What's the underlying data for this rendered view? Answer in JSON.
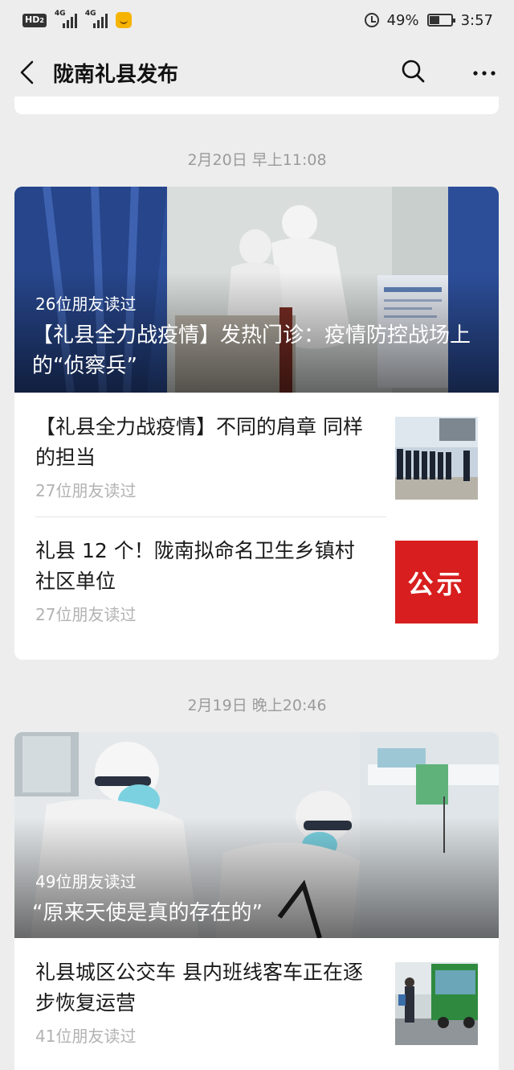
{
  "status_bar": {
    "hd": "HD",
    "hd_sub": "2",
    "net1": "4G",
    "net2": "4G",
    "battery_pct": "49%",
    "time": "3:57"
  },
  "header": {
    "title": "陇南礼县发布",
    "icons": [
      "back-icon",
      "search-icon",
      "more-icon"
    ]
  },
  "groups": [
    {
      "date": "2月20日 早上11:08",
      "hero": {
        "reads": "26位朋友读过",
        "title": "【礼县全力战疫情】发热门诊：疫情防控战场上的“侦察兵”"
      },
      "items": [
        {
          "title": "【礼县全力战疫情】不同的肩章 同样的担当",
          "reads": "27位朋友读过"
        },
        {
          "title": "礼县 12 个！陇南拟命名卫生乡镇村社区单位",
          "reads": "27位朋友读过",
          "thumb_text": "公示"
        }
      ]
    },
    {
      "date": "2月19日 晚上20:46",
      "hero": {
        "reads": "49位朋友读过",
        "title": "“原来天使是真的存在的”"
      },
      "items": [
        {
          "title": "礼县城区公交车 县内班线客车正在逐步恢复运营",
          "reads": "41位朋友读过"
        }
      ]
    }
  ],
  "colors": {
    "background": "#ededed",
    "card": "#ffffff",
    "muted_text": "#b2b2b2",
    "date_text": "#9b9b9b",
    "announce_red": "#d81e1e"
  }
}
